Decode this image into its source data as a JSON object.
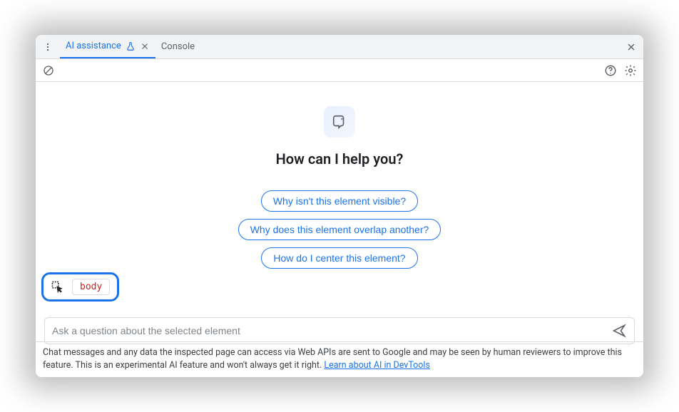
{
  "tabs": {
    "ai_assistance": "AI assistance",
    "console": "Console"
  },
  "main": {
    "heading": "How can I help you?",
    "suggestions": [
      "Why isn't this element visible?",
      "Why does this element overlap another?",
      "How do I center this element?"
    ]
  },
  "selector": {
    "element": "body"
  },
  "input": {
    "placeholder": "Ask a question about the selected element"
  },
  "footer": {
    "text": "Chat messages and any data the inspected page can access via Web APIs are sent to Google and may be seen by human reviewers to improve this feature. This is an experimental AI feature and won't always get it right. ",
    "link_text": "Learn about AI in DevTools"
  }
}
